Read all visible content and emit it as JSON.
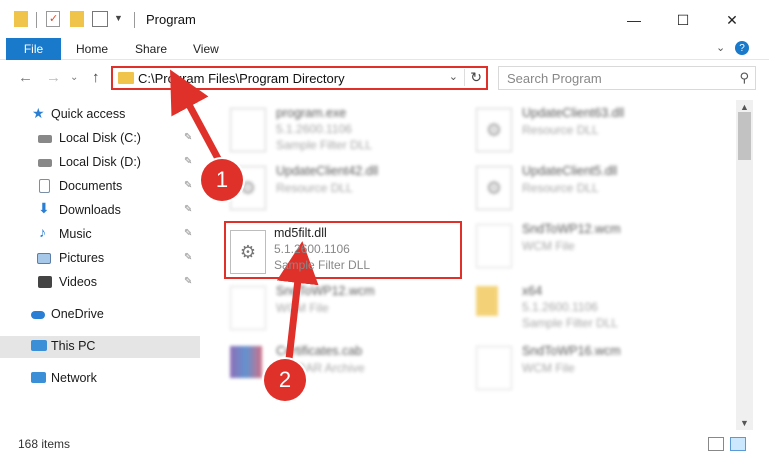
{
  "window": {
    "title": "Program",
    "minimize_glyph": "—",
    "maximize_glyph": "☐",
    "close_glyph": "✕"
  },
  "ribbon": {
    "tabs": [
      "File",
      "Home",
      "Share",
      "View"
    ],
    "collapse_glyph": "⌄",
    "help_glyph": "?"
  },
  "nav": {
    "back_glyph": "←",
    "forward_glyph": "→",
    "recent_glyph": "⌄",
    "up_glyph": "↑",
    "address": "C:\\Program Files\\Program Directory",
    "dropdown_glyph": "⌄",
    "refresh_glyph": "↻",
    "search_placeholder": "Search Program",
    "search_glyph": "⚲"
  },
  "sidebar": {
    "items": [
      {
        "label": "Quick access",
        "icon": "star-icon",
        "pinned": false
      },
      {
        "label": "Local Disk (C:)",
        "icon": "drive-icon",
        "pinned": true
      },
      {
        "label": "Local Disk (D:)",
        "icon": "drive-icon",
        "pinned": true
      },
      {
        "label": "Documents",
        "icon": "document-icon",
        "pinned": true
      },
      {
        "label": "Downloads",
        "icon": "download-icon",
        "pinned": true
      },
      {
        "label": "Music",
        "icon": "music-icon",
        "pinned": true
      },
      {
        "label": "Pictures",
        "icon": "picture-icon",
        "pinned": true
      },
      {
        "label": "Videos",
        "icon": "video-icon",
        "pinned": true
      },
      {
        "label": "OneDrive",
        "icon": "cloud-icon",
        "pinned": false
      },
      {
        "label": "This PC",
        "icon": "computer-icon",
        "pinned": false
      },
      {
        "label": "Network",
        "icon": "network-icon",
        "pinned": false
      }
    ],
    "pin_glyph": "📌"
  },
  "files": [
    {
      "name": "program.exe",
      "version": "5.1.2600.1106",
      "type": "Sample Filter DLL",
      "icon": "exe-icon"
    },
    {
      "name": "UpdateClient63.dll",
      "version": "",
      "type": "Resource DLL",
      "icon": "dll-icon"
    },
    {
      "name": "UpdateClient42.dll",
      "version": "",
      "type": "Resource DLL",
      "icon": "dll-icon"
    },
    {
      "name": "UpdateClient5.dll",
      "version": "",
      "type": "Resource DLL",
      "icon": "dll-icon"
    },
    {
      "name": "md5filt.dll",
      "version": "5.1.2600.1106",
      "type": "Sample Filter DLL",
      "icon": "gear-file-icon"
    },
    {
      "name": "SndToWP12.wcm",
      "version": "",
      "type": "WCM File",
      "icon": "file-icon"
    },
    {
      "name": "SndToWP12.wcm",
      "version": "",
      "type": "WCM File",
      "icon": "file-icon"
    },
    {
      "name": "x64",
      "version": "5.1.2600.1106",
      "type": "Sample Filter DLL",
      "icon": "folder-icon"
    },
    {
      "name": "Certificates.cab",
      "version": "",
      "type": "WinRAR Archive",
      "icon": "archive-icon"
    },
    {
      "name": "SndToWP16.wcm",
      "version": "",
      "type": "WCM File",
      "icon": "file-icon"
    }
  ],
  "status": {
    "item_count": "168 items"
  },
  "annotations": {
    "badge1": "1",
    "badge2": "2"
  },
  "colors": {
    "accent": "#1979ca",
    "highlight_red": "#e0302a",
    "selected_bg": "#cce8ff"
  }
}
